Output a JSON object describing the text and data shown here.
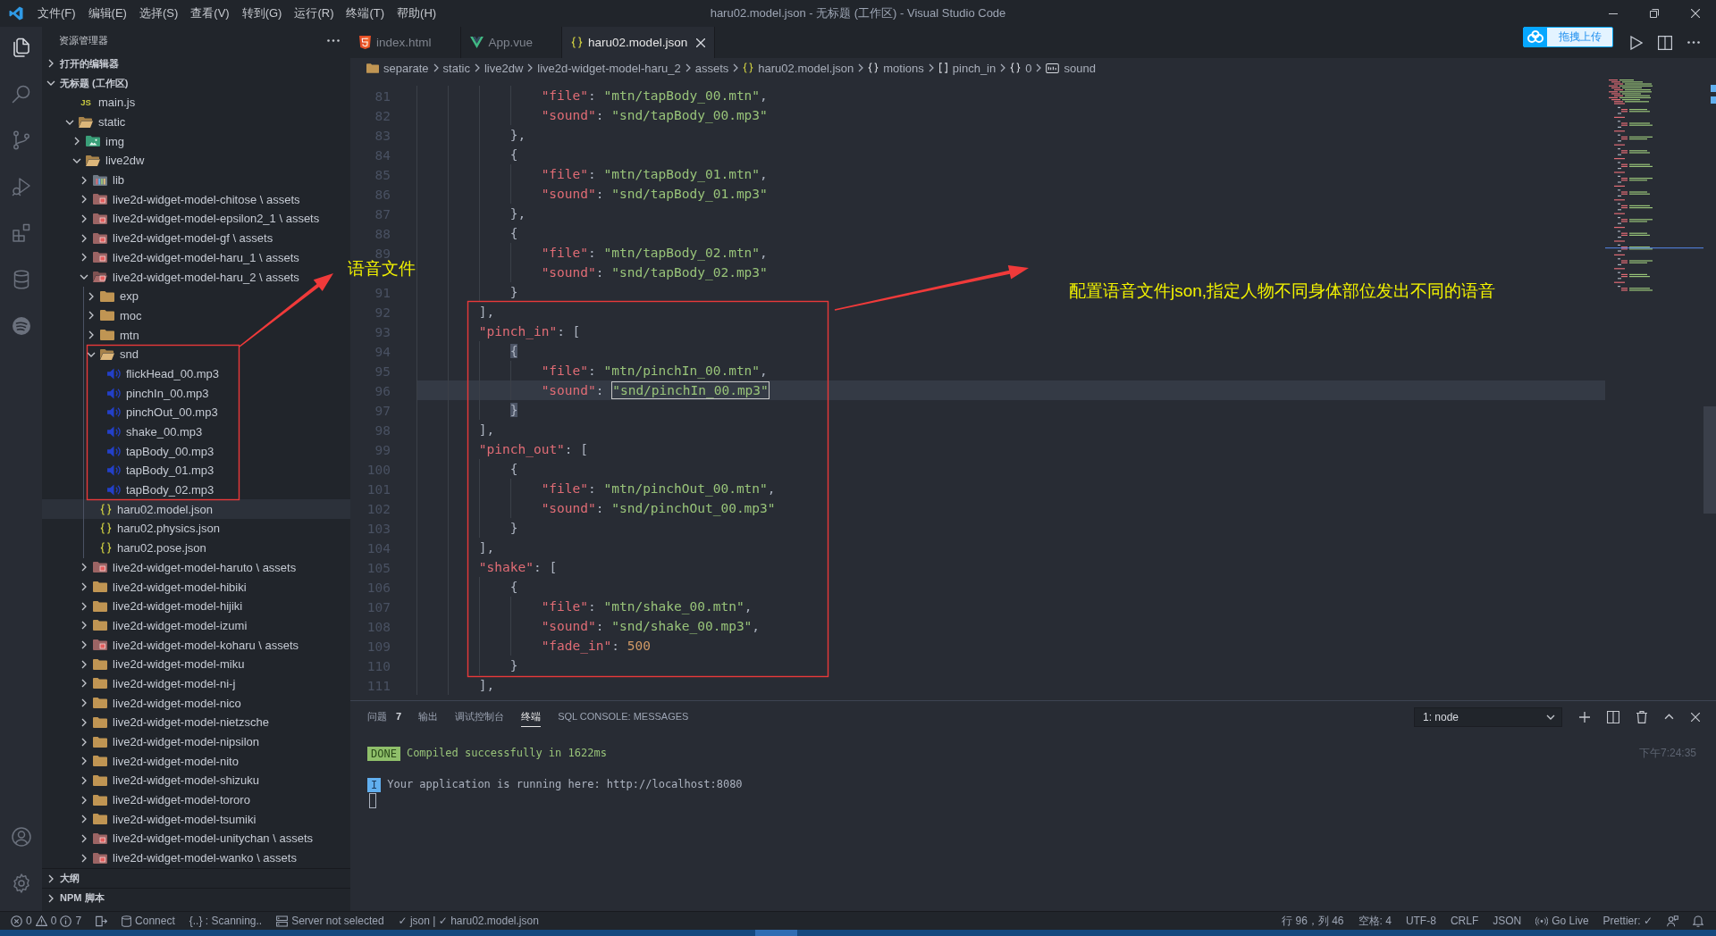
{
  "title_bar": {
    "menu": [
      "文件(F)",
      "编辑(E)",
      "选择(S)",
      "查看(V)",
      "转到(G)",
      "运行(R)",
      "终端(T)",
      "帮助(H)"
    ],
    "title": "haru02.model.json - 无标题 (工作区) - Visual Studio Code"
  },
  "activity_bar": {
    "items": [
      {
        "kind": "explorer",
        "selected": true
      },
      {
        "kind": "search",
        "selected": false
      },
      {
        "kind": "source-control",
        "selected": false
      },
      {
        "kind": "run-debug",
        "selected": false
      },
      {
        "kind": "extensions",
        "selected": false
      },
      {
        "kind": "database",
        "selected": false
      },
      {
        "kind": "spotify",
        "selected": false
      }
    ],
    "bottom": [
      {
        "kind": "account"
      },
      {
        "kind": "settings"
      }
    ]
  },
  "sidebar": {
    "title": "资源管理器",
    "sections": [
      {
        "label": "打开的编辑器",
        "expanded": false
      },
      {
        "label": "无标题 (工作区)",
        "expanded": true
      }
    ],
    "tree": [
      {
        "kind": "js",
        "icon": "JS",
        "name": "main.js",
        "selected": false
      },
      {
        "kind": "folder",
        "name": "static",
        "expanded": true,
        "selected": false,
        "children": [
          {
            "kind": "image-folder",
            "name": "img",
            "expanded": false,
            "selected": false
          },
          {
            "kind": "folder",
            "name": "live2dw",
            "expanded": true,
            "selected": false,
            "children": [
              {
                "kind": "lib-folder",
                "name": "lib",
                "expanded": false,
                "selected": false
              },
              {
                "kind": "assets-folder",
                "name": "live2d-widget-model-chitose \\ assets",
                "expanded": false,
                "selected": false
              },
              {
                "kind": "assets-folder",
                "name": "live2d-widget-model-epsilon2_1 \\ assets",
                "expanded": false,
                "selected": false
              },
              {
                "kind": "assets-folder",
                "name": "live2d-widget-model-gf \\ assets",
                "expanded": false,
                "selected": false
              },
              {
                "kind": "assets-folder",
                "name": "live2d-widget-model-haru_1 \\ assets",
                "expanded": false,
                "selected": false
              },
              {
                "kind": "assets-folder",
                "name": "live2d-widget-model-haru_2 \\ assets",
                "expanded": true,
                "selected": false,
                "children": [
                  {
                    "kind": "folder",
                    "name": "exp",
                    "expanded": false,
                    "selected": false
                  },
                  {
                    "kind": "folder",
                    "name": "moc",
                    "expanded": false,
                    "selected": false
                  },
                  {
                    "kind": "folder",
                    "name": "mtn",
                    "expanded": false,
                    "selected": false
                  },
                  {
                    "kind": "folder",
                    "name": "snd",
                    "expanded": true,
                    "selected": false,
                    "children": [
                      {
                        "kind": "audio",
                        "name": "flickHead_00.mp3",
                        "selected": false
                      },
                      {
                        "kind": "audio",
                        "name": "pinchIn_00.mp3",
                        "selected": false
                      },
                      {
                        "kind": "audio",
                        "name": "pinchOut_00.mp3",
                        "selected": false
                      },
                      {
                        "kind": "audio",
                        "name": "shake_00.mp3",
                        "selected": false
                      },
                      {
                        "kind": "audio",
                        "name": "tapBody_00.mp3",
                        "selected": false
                      },
                      {
                        "kind": "audio",
                        "name": "tapBody_01.mp3",
                        "selected": false
                      },
                      {
                        "kind": "audio",
                        "name": "tapBody_02.mp3",
                        "selected": false
                      }
                    ]
                  },
                  {
                    "kind": "json",
                    "name": "haru02.model.json",
                    "selected": true
                  },
                  {
                    "kind": "json",
                    "name": "haru02.physics.json",
                    "selected": false
                  },
                  {
                    "kind": "json",
                    "name": "haru02.pose.json",
                    "selected": false
                  }
                ]
              },
              {
                "kind": "assets-folder",
                "name": "live2d-widget-model-haruto \\ assets",
                "expanded": false,
                "selected": false
              },
              {
                "kind": "folder",
                "name": "live2d-widget-model-hibiki",
                "expanded": false,
                "selected": false
              },
              {
                "kind": "folder",
                "name": "live2d-widget-model-hijiki",
                "expanded": false,
                "selected": false
              },
              {
                "kind": "folder",
                "name": "live2d-widget-model-izumi",
                "expanded": false,
                "selected": false
              },
              {
                "kind": "assets-folder",
                "name": "live2d-widget-model-koharu \\ assets",
                "expanded": false,
                "selected": false
              },
              {
                "kind": "folder",
                "name": "live2d-widget-model-miku",
                "expanded": false,
                "selected": false
              },
              {
                "kind": "folder",
                "name": "live2d-widget-model-ni-j",
                "expanded": false,
                "selected": false
              },
              {
                "kind": "folder",
                "name": "live2d-widget-model-nico",
                "expanded": false,
                "selected": false
              },
              {
                "kind": "folder",
                "name": "live2d-widget-model-nietzsche",
                "expanded": false,
                "selected": false
              },
              {
                "kind": "folder",
                "name": "live2d-widget-model-nipsilon",
                "expanded": false,
                "selected": false
              },
              {
                "kind": "folder",
                "name": "live2d-widget-model-nito",
                "expanded": false,
                "selected": false
              },
              {
                "kind": "folder",
                "name": "live2d-widget-model-shizuku",
                "expanded": false,
                "selected": false
              },
              {
                "kind": "folder",
                "name": "live2d-widget-model-tororo",
                "expanded": false,
                "selected": false
              },
              {
                "kind": "folder",
                "name": "live2d-widget-model-tsumiki",
                "expanded": false,
                "selected": false
              },
              {
                "kind": "assets-folder",
                "name": "live2d-widget-model-unitychan \\ assets",
                "expanded": false,
                "selected": false
              },
              {
                "kind": "assets-folder",
                "name": "live2d-widget-model-wanko \\ assets",
                "expanded": false,
                "selected": false
              }
            ]
          }
        ]
      }
    ],
    "bottom_sections": [
      {
        "label": "大纲",
        "expanded": false
      },
      {
        "label": "NPM 脚本",
        "expanded": false
      }
    ]
  },
  "editor": {
    "tabs": [
      {
        "kind": "html",
        "label": "index.html",
        "selected": false
      },
      {
        "kind": "vue",
        "label": "App.vue",
        "selected": false
      },
      {
        "kind": "json",
        "label": "haru02.model.json",
        "selected": true
      }
    ],
    "upload_button": {
      "label": "拖拽上传"
    },
    "breadcrumb": [
      {
        "kind": "folder",
        "label": "separate"
      },
      {
        "kind": "plain",
        "label": "static"
      },
      {
        "kind": "plain",
        "label": "live2dw"
      },
      {
        "kind": "plain",
        "label": "live2d-widget-model-haru_2"
      },
      {
        "kind": "plain",
        "label": "assets"
      },
      {
        "kind": "json-file",
        "label": "haru02.model.json"
      },
      {
        "kind": "object",
        "label": "motions"
      },
      {
        "kind": "array",
        "label": "pinch_in"
      },
      {
        "kind": "object",
        "label": "0"
      },
      {
        "kind": "string",
        "label": "sound"
      }
    ],
    "lines": [
      {
        "number": "81",
        "current": false,
        "tokens": [
          {
            "kind": "key",
            "text": "                \"file\""
          },
          {
            "kind": "punct",
            "text": ": "
          },
          {
            "kind": "string",
            "text": "\"mtn/tapBody_00.mtn\""
          },
          {
            "kind": "punct",
            "text": ","
          }
        ]
      },
      {
        "number": "82",
        "current": false,
        "tokens": [
          {
            "kind": "key",
            "text": "                \"sound\""
          },
          {
            "kind": "punct",
            "text": ": "
          },
          {
            "kind": "string",
            "text": "\"snd/tapBody_00.mp3\""
          }
        ]
      },
      {
        "number": "83",
        "current": false,
        "tokens": [
          {
            "kind": "punct",
            "text": "            },"
          }
        ]
      },
      {
        "number": "84",
        "current": false,
        "tokens": [
          {
            "kind": "punct",
            "text": "            {"
          }
        ]
      },
      {
        "number": "85",
        "current": false,
        "tokens": [
          {
            "kind": "key",
            "text": "                \"file\""
          },
          {
            "kind": "punct",
            "text": ": "
          },
          {
            "kind": "string",
            "text": "\"mtn/tapBody_01.mtn\""
          },
          {
            "kind": "punct",
            "text": ","
          }
        ]
      },
      {
        "number": "86",
        "current": false,
        "tokens": [
          {
            "kind": "key",
            "text": "                \"sound\""
          },
          {
            "kind": "punct",
            "text": ": "
          },
          {
            "kind": "string",
            "text": "\"snd/tapBody_01.mp3\""
          }
        ]
      },
      {
        "number": "87",
        "current": false,
        "tokens": [
          {
            "kind": "punct",
            "text": "            },"
          }
        ]
      },
      {
        "number": "88",
        "current": false,
        "tokens": [
          {
            "kind": "punct",
            "text": "            {"
          }
        ]
      },
      {
        "number": "89",
        "current": false,
        "tokens": [
          {
            "kind": "key",
            "text": "                \"file\""
          },
          {
            "kind": "punct",
            "text": ": "
          },
          {
            "kind": "string",
            "text": "\"mtn/tapBody_02.mtn\""
          },
          {
            "kind": "punct",
            "text": ","
          }
        ]
      },
      {
        "current": false,
        "tokens": [
          {
            "kind": "key",
            "text": "                \"sound\""
          },
          {
            "kind": "punct",
            "text": ": "
          },
          {
            "kind": "string",
            "text": "\"snd/tapBody_02.mp3\""
          }
        ]
      },
      {
        "number": "91",
        "current": false,
        "tokens": [
          {
            "kind": "punct",
            "text": "            }"
          }
        ]
      },
      {
        "number": "92",
        "current": false,
        "tokens": [
          {
            "kind": "punct",
            "text": "        ],"
          }
        ]
      },
      {
        "number": "93",
        "current": false,
        "tokens": [
          {
            "kind": "key",
            "text": "        \"pinch_in\""
          },
          {
            "kind": "punct",
            "text": ": ["
          }
        ]
      },
      {
        "number": "94",
        "current": false,
        "tokens": [
          {
            "kind": "match-bracket",
            "text": "            {"
          }
        ]
      },
      {
        "number": "95",
        "current": false,
        "tokens": [
          {
            "kind": "key",
            "text": "                \"file\""
          },
          {
            "kind": "punct",
            "text": ": "
          },
          {
            "kind": "string",
            "text": "\"mtn/pinchIn_00.mtn\""
          },
          {
            "kind": "punct",
            "text": ","
          }
        ]
      },
      {
        "number": "96",
        "current": true,
        "tokens": [
          {
            "kind": "key",
            "text": "                \"sound\""
          },
          {
            "kind": "punct",
            "text": ": "
          },
          {
            "kind": "highlighted-string",
            "text": "\"snd/pinchIn_00.mp3\""
          }
        ]
      },
      {
        "number": "97",
        "current": false,
        "tokens": [
          {
            "kind": "match-bracket",
            "text": "            }"
          }
        ]
      },
      {
        "number": "98",
        "current": false,
        "tokens": [
          {
            "kind": "punct",
            "text": "        ],"
          }
        ]
      },
      {
        "number": "99",
        "current": false,
        "tokens": [
          {
            "kind": "key",
            "text": "        \"pinch_out\""
          },
          {
            "kind": "punct",
            "text": ": ["
          }
        ]
      },
      {
        "number": "100",
        "current": false,
        "tokens": [
          {
            "kind": "punct",
            "text": "            {"
          }
        ]
      },
      {
        "number": "101",
        "current": false,
        "tokens": [
          {
            "kind": "key",
            "text": "                \"file\""
          },
          {
            "kind": "punct",
            "text": ": "
          },
          {
            "kind": "string",
            "text": "\"mtn/pinchOut_00.mtn\""
          },
          {
            "kind": "punct",
            "text": ","
          }
        ]
      },
      {
        "number": "102",
        "current": false,
        "tokens": [
          {
            "kind": "key",
            "text": "                \"sound\""
          },
          {
            "kind": "punct",
            "text": ": "
          },
          {
            "kind": "string",
            "text": "\"snd/pinchOut_00.mp3\""
          }
        ]
      },
      {
        "number": "103",
        "current": false,
        "tokens": [
          {
            "kind": "punct",
            "text": "            }"
          }
        ]
      },
      {
        "number": "104",
        "current": false,
        "tokens": [
          {
            "kind": "punct",
            "text": "        ],"
          }
        ]
      },
      {
        "number": "105",
        "current": false,
        "tokens": [
          {
            "kind": "key",
            "text": "        \"shake\""
          },
          {
            "kind": "punct",
            "text": ": ["
          }
        ]
      },
      {
        "number": "106",
        "current": false,
        "tokens": [
          {
            "kind": "punct",
            "text": "            {"
          }
        ]
      },
      {
        "number": "107",
        "current": false,
        "tokens": [
          {
            "kind": "key",
            "text": "                \"file\""
          },
          {
            "kind": "punct",
            "text": ": "
          },
          {
            "kind": "string",
            "text": "\"mtn/shake_00.mtn\""
          },
          {
            "kind": "punct",
            "text": ","
          }
        ]
      },
      {
        "number": "108",
        "current": false,
        "tokens": [
          {
            "kind": "key",
            "text": "                \"sound\""
          },
          {
            "kind": "punct",
            "text": ": "
          },
          {
            "kind": "string",
            "text": "\"snd/shake_00.mp3\""
          },
          {
            "kind": "punct",
            "text": ","
          }
        ]
      },
      {
        "number": "109",
        "current": false,
        "tokens": [
          {
            "kind": "key",
            "text": "                \"fade_in\""
          },
          {
            "kind": "punct",
            "text": ": "
          },
          {
            "kind": "number",
            "text": "500"
          }
        ]
      },
      {
        "number": "110",
        "current": false,
        "tokens": [
          {
            "kind": "punct",
            "text": "            }"
          }
        ]
      },
      {
        "number": "111",
        "current": false,
        "tokens": [
          {
            "kind": "punct",
            "text": "        ],"
          }
        ]
      }
    ]
  },
  "panel": {
    "tabs": [
      {
        "label": "问题",
        "badge": "7",
        "selected": false
      },
      {
        "label": "输出",
        "selected": false
      },
      {
        "label": "调试控制台",
        "selected": false
      },
      {
        "label": "终端",
        "selected": true
      },
      {
        "label": "SQL CONSOLE: MESSAGES",
        "selected": false
      }
    ],
    "terminal_picker": {
      "value": "1: node"
    },
    "terminal": {
      "lines": [
        {
          "kind": "success",
          "badge": "DONE",
          "text": "Compiled successfully in 1622ms"
        },
        {
          "kind": "info",
          "badge": "I",
          "text": "Your application is running here: http://localhost:8080"
        }
      ],
      "timestamp": "下午7:24:35"
    }
  },
  "status_bar": {
    "problems": {
      "errors": "0",
      "warnings": "0",
      "infos": "7"
    },
    "left": [
      {
        "kind": "port"
      },
      {
        "kind": "database",
        "label": "Connect"
      },
      {
        "kind": "text",
        "label": "{..} : Scanning.."
      },
      {
        "kind": "server",
        "label": "Server not selected"
      },
      {
        "kind": "text",
        "label": "✓ json | ✓ haru02.model.json"
      }
    ],
    "right": [
      {
        "kind": "text",
        "label": "行 96，列 46"
      },
      {
        "kind": "text",
        "label": "空格: 4"
      },
      {
        "kind": "text",
        "label": "UTF-8"
      },
      {
        "kind": "text",
        "label": "CRLF"
      },
      {
        "kind": "text",
        "label": "JSON"
      },
      {
        "kind": "broadcast",
        "label": "Go Live"
      },
      {
        "kind": "text",
        "label": "Prettier: ✓"
      },
      {
        "kind": "feedback"
      },
      {
        "kind": "bell"
      }
    ]
  },
  "annotations": [
    {
      "text": "语音文件"
    },
    {
      "text": "配置语音文件json,指定人物不同身体部位发出不同的语音"
    }
  ]
}
